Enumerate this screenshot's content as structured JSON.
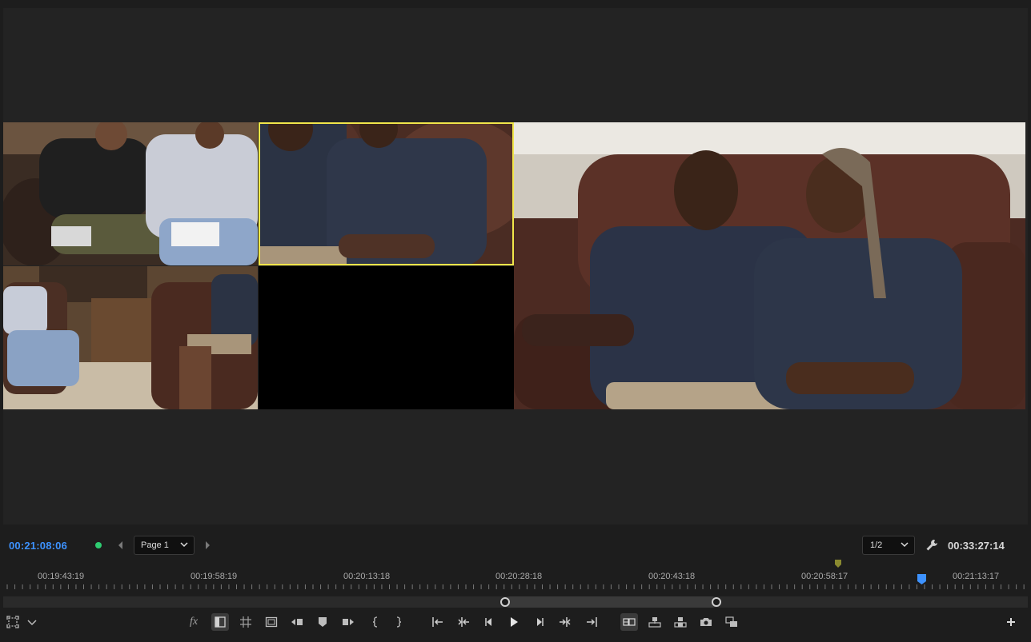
{
  "monitor": {
    "current_timecode": "00:21:08:06",
    "duration_timecode": "00:33:27:14",
    "page_select": {
      "selected": "Page 1"
    },
    "zoom_select": {
      "selected": "1/2"
    }
  },
  "ruler": {
    "labels": [
      "00:19:43:19",
      "00:19:58:19",
      "00:20:13:18",
      "00:20:28:18",
      "00:20:43:18",
      "00:20:58:17",
      "00:21:13:17"
    ]
  },
  "colors": {
    "accent": "#3d92ff",
    "status_green": "#2ecc71",
    "active_camera_border": "#f1e64a",
    "marker": "#7a7a2a"
  },
  "toolbar": {
    "fx_label": "fx",
    "icons": [
      "safe-margins-icon",
      "dropdown-chevron-icon",
      "fx-icon",
      "comparison-view-icon",
      "grid-icon",
      "frame-icon",
      "lift-icon",
      "add-marker-icon",
      "extract-icon",
      "mark-in-icon",
      "mark-out-icon",
      "go-to-in-icon",
      "previous-edit-icon",
      "step-back-icon",
      "play-icon",
      "step-forward-icon",
      "next-edit-icon",
      "go-to-out-icon",
      "multicam-view-icon",
      "insert-icon",
      "overwrite-icon",
      "export-frame-icon",
      "proxy-toggle-icon",
      "add-button-icon"
    ]
  }
}
